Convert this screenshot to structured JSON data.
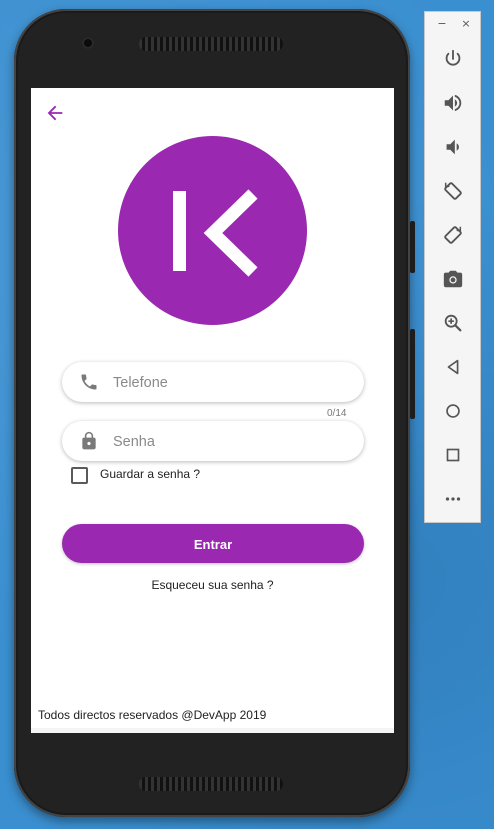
{
  "app": {
    "phone_input": {
      "placeholder": "Telefone",
      "counter": "0/14"
    },
    "password_input": {
      "placeholder": "Senha"
    },
    "remember": {
      "label": "Guardar a senha ?",
      "checked": false
    },
    "login_button": {
      "label": "Entrar"
    },
    "forgot_link": {
      "label": "Esqueceu sua senha ?"
    },
    "footer": {
      "text": "Todos directos reservados @DevApp 2019"
    },
    "colors": {
      "accent": "#9a28b0",
      "background": "#ffffff"
    }
  },
  "emulator_toolbar": {
    "window_controls": [
      "−",
      "×"
    ],
    "buttons": [
      "power-icon",
      "volume-up-icon",
      "volume-down-icon",
      "rotate-left-icon",
      "rotate-right-icon",
      "camera-icon",
      "zoom-icon",
      "back-icon",
      "home-icon",
      "overview-icon",
      "more-icon"
    ]
  }
}
